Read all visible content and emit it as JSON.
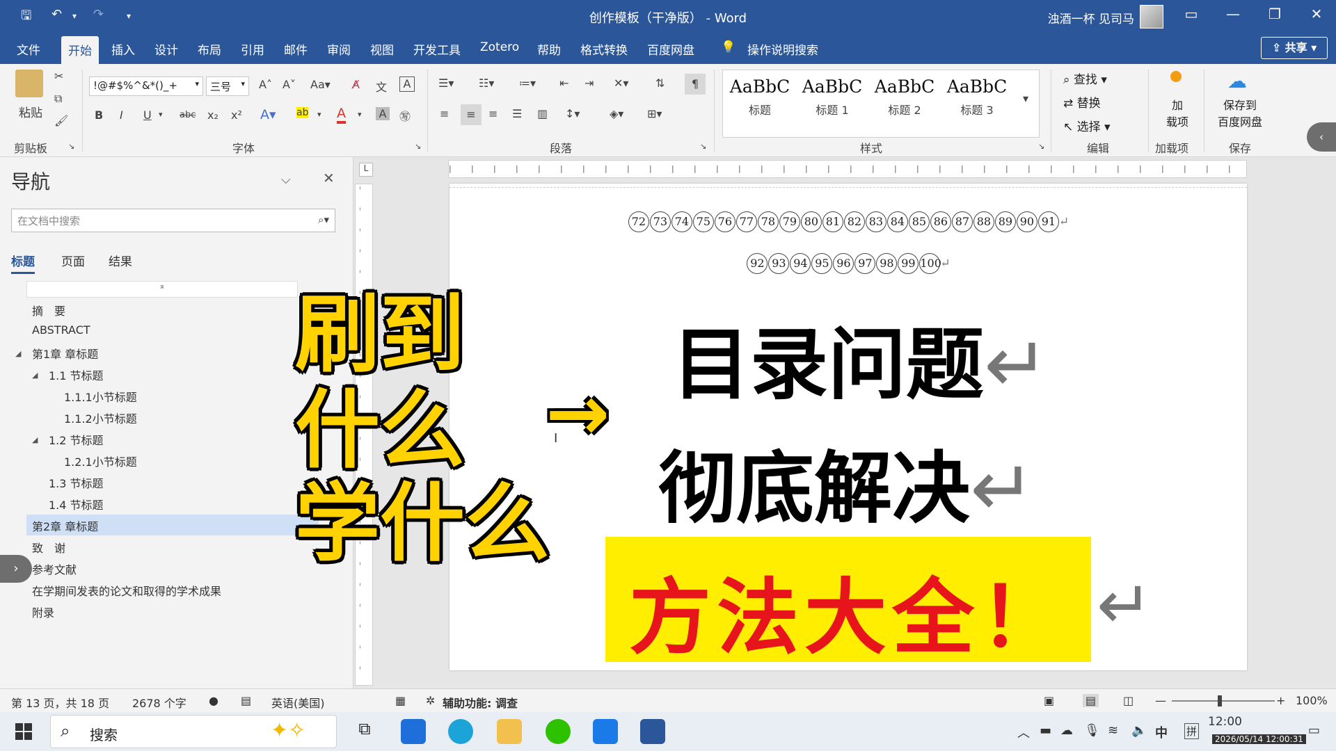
{
  "titlebar": {
    "doc_title": "创作模板（干净版） - Word",
    "user_name": "浊酒一杯 见司马",
    "icons": [
      "save-icon",
      "undo-icon",
      "redo-icon",
      "customize-icon"
    ]
  },
  "menu": {
    "tabs": [
      "文件",
      "开始",
      "插入",
      "设计",
      "布局",
      "引用",
      "邮件",
      "审阅",
      "视图",
      "开发工具",
      "Zotero",
      "帮助",
      "格式转换",
      "百度网盘"
    ],
    "active": "开始",
    "tell_me": "操作说明搜索",
    "share": "共享"
  },
  "ribbon": {
    "clipboard": {
      "label": "剪贴板",
      "paste": "粘贴"
    },
    "font": {
      "label": "字体",
      "name": "!@#$%^&*()_+",
      "size": "三号",
      "buttons": [
        "B",
        "I",
        "U",
        "abc",
        "x₂",
        "x²"
      ]
    },
    "paragraph": {
      "label": "段落"
    },
    "styles": {
      "label": "样式",
      "items": [
        {
          "sample": "AaBbC",
          "name": "标题"
        },
        {
          "sample": "AaBbC",
          "name": "标题 1"
        },
        {
          "sample": "AaBbC",
          "name": "标题 2"
        },
        {
          "sample": "AaBbC",
          "name": "标题 3"
        }
      ]
    },
    "editing": {
      "label": "编辑",
      "find": "查找",
      "replace": "替换",
      "select": "选择"
    },
    "addins": {
      "label": "加载项",
      "button": "加\n载项"
    },
    "save": {
      "label": "保存",
      "button": "保存到\n百度网盘"
    }
  },
  "nav": {
    "title": "导航",
    "search_placeholder": "在文档中搜索",
    "tabs": [
      "标题",
      "页面",
      "结果"
    ],
    "items": [
      {
        "text": "摘　要",
        "level": 0
      },
      {
        "text": "ABSTRACT",
        "level": 0
      },
      {
        "text": "第1章 章标题",
        "level": 0,
        "expanded": true
      },
      {
        "text": "1.1 节标题",
        "level": 1,
        "expanded": true
      },
      {
        "text": "1.1.1小节标题",
        "level": 2
      },
      {
        "text": "1.1.2小节标题",
        "level": 2
      },
      {
        "text": "1.2 节标题",
        "level": 1,
        "expanded": true
      },
      {
        "text": "1.2.1小节标题",
        "level": 2
      },
      {
        "text": "1.3 节标题",
        "level": 1
      },
      {
        "text": "1.4 节标题",
        "level": 1
      },
      {
        "text": "第2章 章标题",
        "level": 0,
        "selected": true
      },
      {
        "text": "致　谢",
        "level": 0
      },
      {
        "text": "参考文献",
        "level": 0
      },
      {
        "text": "在学期间发表的论文和取得的学术成果",
        "level": 0
      },
      {
        "text": "附录",
        "level": 0
      }
    ]
  },
  "document": {
    "row1": [
      "72",
      "73",
      "74",
      "75",
      "76",
      "77",
      "78",
      "79",
      "80",
      "81",
      "82",
      "83",
      "84",
      "85",
      "86",
      "87",
      "88",
      "89",
      "90",
      "91"
    ],
    "row2": [
      "92",
      "93",
      "94",
      "95",
      "96",
      "97",
      "98",
      "99",
      "100"
    ],
    "line1": "目录问题",
    "line2": "彻底解决",
    "banner": "方法大全！",
    "enter_mark": "↵"
  },
  "overlay": {
    "lines": [
      "刷到",
      "什么",
      "学什么"
    ],
    "arrow": "→"
  },
  "status": {
    "page": "第 13 页，共 18 页",
    "words": "2678 个字",
    "language": "英语(美国)",
    "accessibility": "辅助功能: 调查",
    "zoom": "100%"
  },
  "taskbar": {
    "search": "搜索",
    "time": "12:00",
    "date": "2026/05/14 12:00:31",
    "ime1": "中",
    "ime2": "拼"
  },
  "colors": {
    "accent": "#2b579a",
    "overlay_yellow": "#ffd200",
    "banner_yellow": "#ffee00",
    "banner_red": "#e8141c"
  }
}
